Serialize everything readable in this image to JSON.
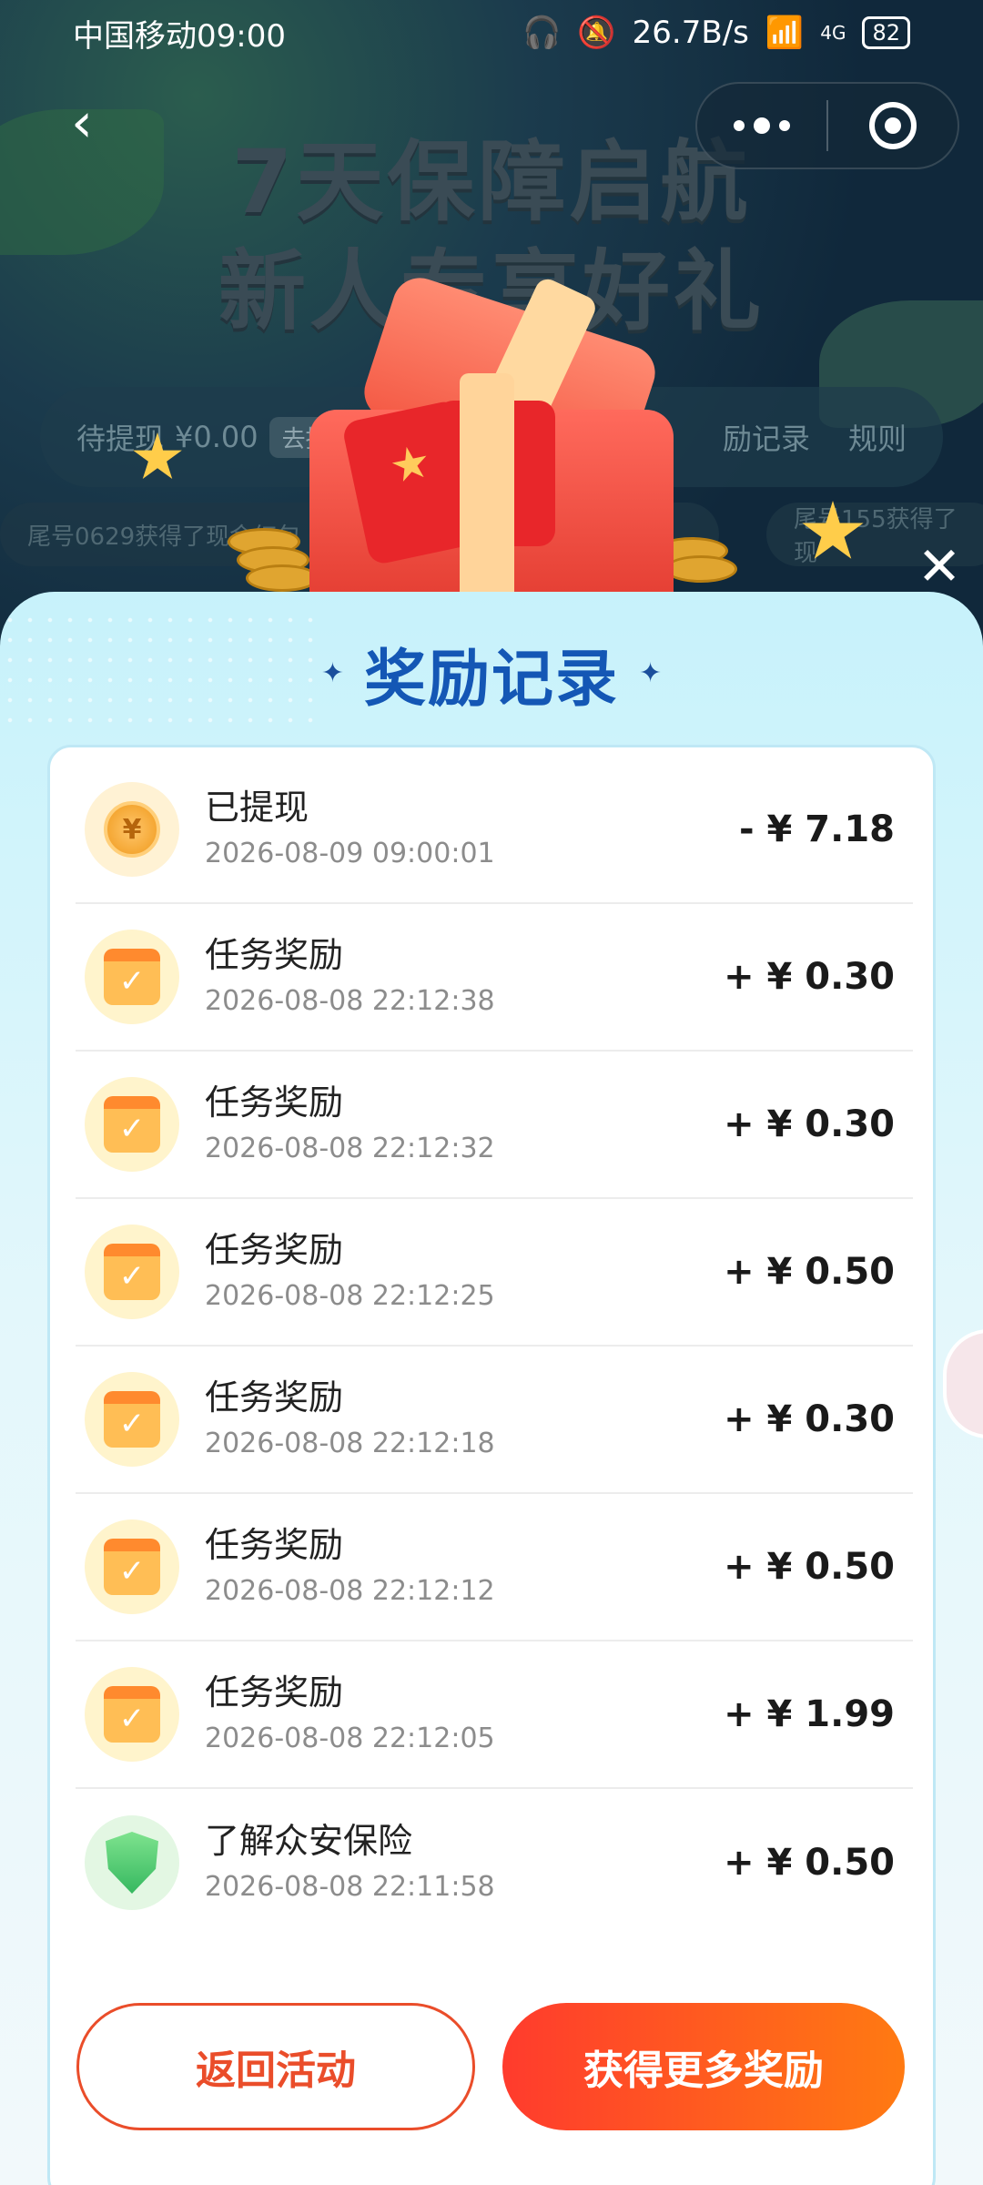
{
  "status_bar": {
    "carrier_time": "中国移动09:00",
    "net_speed": "26.7B/s",
    "signal": "4G",
    "battery": "82"
  },
  "background": {
    "headline_line1": "7天保障启航",
    "headline_line2": "新人专享好礼",
    "pending_label": "待提现",
    "pending_amount": "¥0.00",
    "withdraw_button": "去提现",
    "rewards_link": "励记录",
    "rules_link": "规则",
    "ticker_left": "尾号0629获得了现金红包",
    "ticker_right": "尾号155获得了现"
  },
  "modal": {
    "title": "奖励记录",
    "records": [
      {
        "icon": "coin-icon",
        "title": "已提现",
        "time": "2026-08-09 09:00:01",
        "amount": "- ¥ 7.18"
      },
      {
        "icon": "calendar-check-icon",
        "title": "任务奖励",
        "time": "2026-08-08 22:12:38",
        "amount": "+ ¥ 0.30"
      },
      {
        "icon": "calendar-check-icon",
        "title": "任务奖励",
        "time": "2026-08-08 22:12:32",
        "amount": "+ ¥ 0.30"
      },
      {
        "icon": "calendar-check-icon",
        "title": "任务奖励",
        "time": "2026-08-08 22:12:25",
        "amount": "+ ¥ 0.50"
      },
      {
        "icon": "calendar-check-icon",
        "title": "任务奖励",
        "time": "2026-08-08 22:12:18",
        "amount": "+ ¥ 0.30"
      },
      {
        "icon": "calendar-check-icon",
        "title": "任务奖励",
        "time": "2026-08-08 22:12:12",
        "amount": "+ ¥ 0.50"
      },
      {
        "icon": "calendar-check-icon",
        "title": "任务奖励",
        "time": "2026-08-08 22:12:05",
        "amount": "+ ¥ 1.99"
      },
      {
        "icon": "shield-icon",
        "title": "了解众安保险",
        "time": "2026-08-08 22:11:58",
        "amount": "+ ¥ 0.50"
      }
    ],
    "back_button": "返回活动",
    "more_button": "获得更多奖励"
  },
  "colors": {
    "accent": "#ea4d2a",
    "title_blue": "#1457b5",
    "modal_bg": "#c7f2fb"
  }
}
